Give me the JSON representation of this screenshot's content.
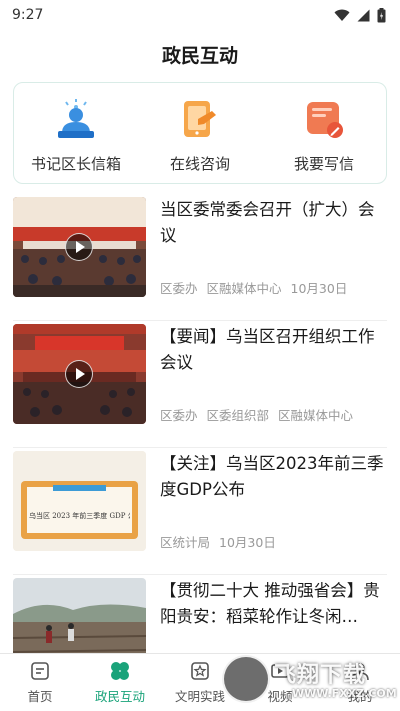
{
  "status_bar": {
    "time": "9:27"
  },
  "header": {
    "title": "政民互动"
  },
  "services": [
    {
      "label": "书记区长信箱",
      "icon": "officials-mailbox-icon"
    },
    {
      "label": "在线咨询",
      "icon": "online-consult-icon"
    },
    {
      "label": "我要写信",
      "icon": "write-letter-icon"
    }
  ],
  "news": [
    {
      "title": "当区委常委会召开（扩大）会议",
      "meta": [
        "区委办",
        "区融媒体中心",
        "10月30日"
      ],
      "has_video": true
    },
    {
      "title": "【要闻】乌当区召开组织工作会议",
      "meta": [
        "区委办",
        "区委组织部",
        "区融媒体中心"
      ],
      "has_video": true
    },
    {
      "title": "【关注】乌当区2023年前三季度GDP公布",
      "meta": [
        "区统计局",
        "10月30日"
      ],
      "has_video": false,
      "thumb_caption": "乌当区 2023 年前三季度 GDP 公布"
    },
    {
      "title": "【贯彻二十大  推动强省会】贵阳贵安：稻菜轮作让冬闲…",
      "meta": [],
      "has_video": false
    }
  ],
  "bottom_nav": {
    "items": [
      {
        "label": "首页"
      },
      {
        "label": "政民互动"
      },
      {
        "label": "文明实践"
      },
      {
        "label": "视频"
      },
      {
        "label": "我的"
      }
    ],
    "active_color": "#1aa37a"
  },
  "watermark": {
    "text": "飞翔下载",
    "url": "WWW.FXXZ.COM"
  },
  "colors": {
    "accent": "#1aa37a",
    "card_border": "#d9ece7",
    "meta_text": "#999999"
  }
}
